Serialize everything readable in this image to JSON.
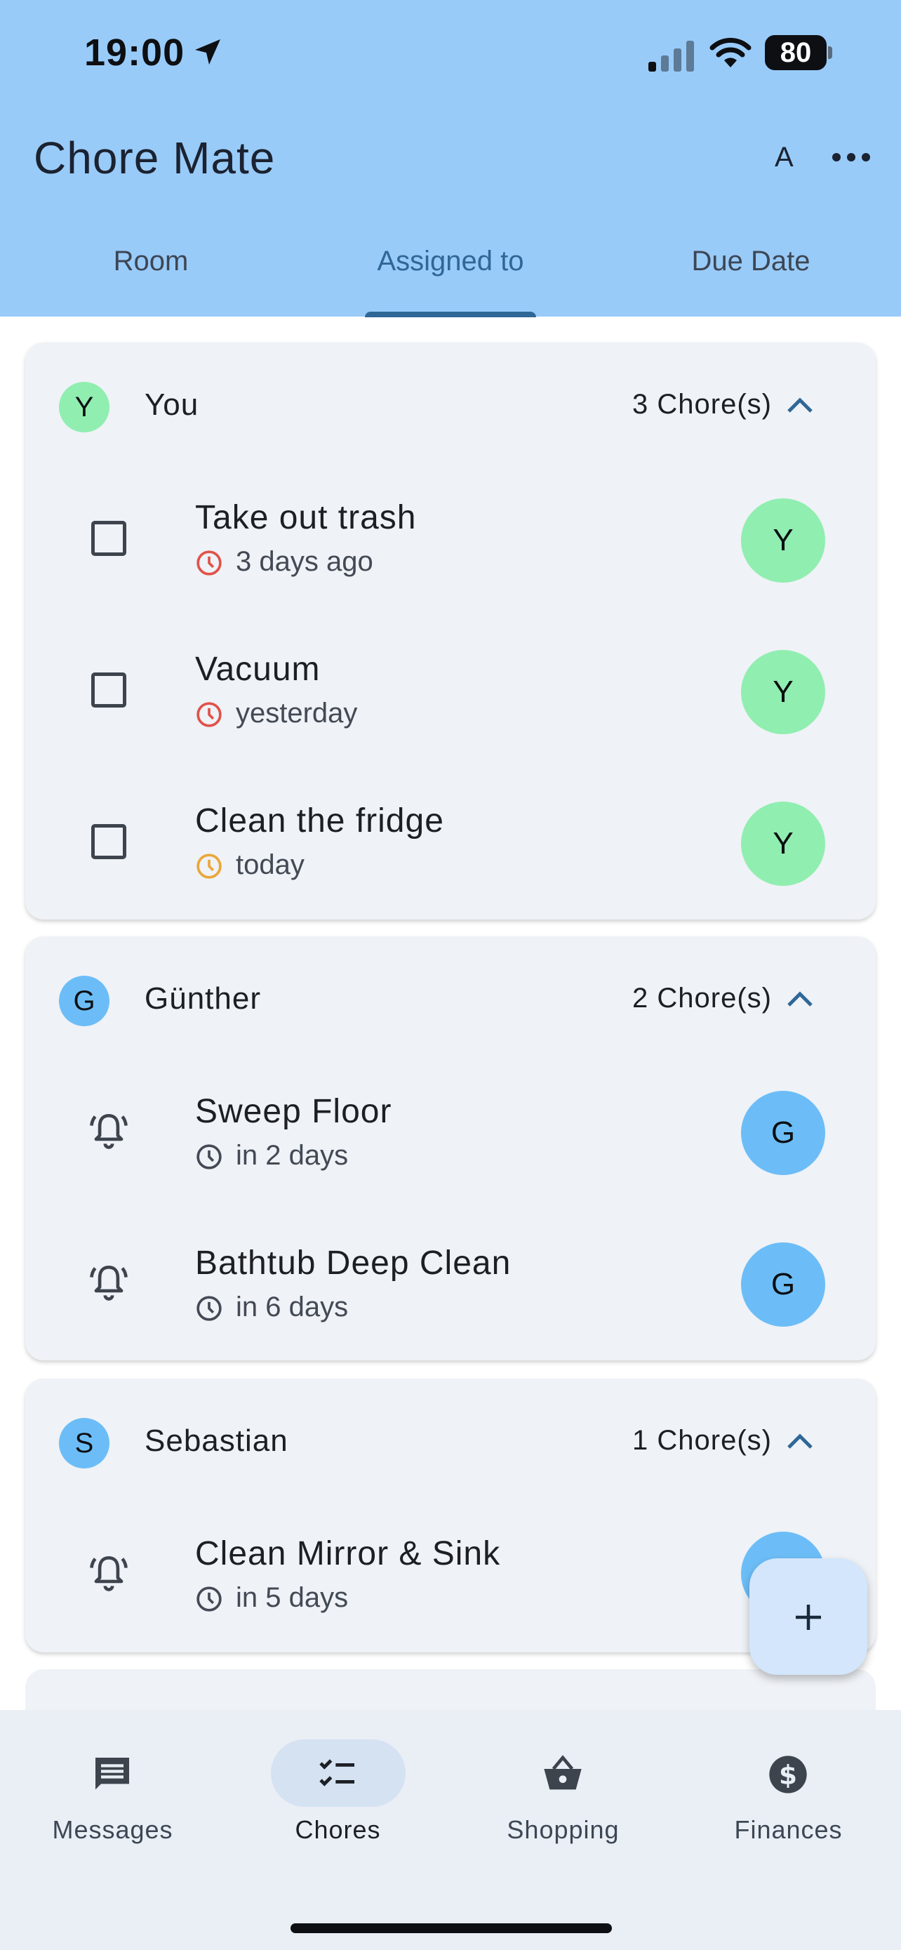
{
  "status_bar": {
    "time": "19:00",
    "battery_level": "80"
  },
  "header": {
    "title": "Chore Mate",
    "font_button": "A"
  },
  "tabs": [
    {
      "label": "Room",
      "active": false
    },
    {
      "label": "Assigned to",
      "active": true
    },
    {
      "label": "Due Date",
      "active": false
    }
  ],
  "groups": [
    {
      "initial": "Y",
      "name": "You",
      "count": "3 Chore(s)",
      "avatar_color": "#90eeb0",
      "chores": [
        {
          "title": "Take out trash",
          "due": "3 days ago",
          "due_color": "#e0524a",
          "avatar": "Y"
        },
        {
          "title": "Vacuum",
          "due": "yesterday",
          "due_color": "#e0524a",
          "avatar": "Y"
        },
        {
          "title": "Clean the fridge",
          "due": "today",
          "due_color": "#eba63a",
          "avatar": "Y"
        }
      ]
    },
    {
      "initial": "G",
      "name": "Günther",
      "count": "2 Chore(s)",
      "avatar_color": "#6cbdf7",
      "chores": [
        {
          "title": "Sweep Floor",
          "due": "in 2 days",
          "due_color": "#434a55",
          "avatar": "G"
        },
        {
          "title": "Bathtub Deep Clean",
          "due": "in 6 days",
          "due_color": "#434a55",
          "avatar": "G"
        }
      ]
    },
    {
      "initial": "S",
      "name": "Sebastian",
      "count": "1 Chore(s)",
      "avatar_color": "#6cbdf7",
      "chores": [
        {
          "title": "Clean Mirror & Sink",
          "due": "in 5 days",
          "due_color": "#434a55",
          "avatar": "S"
        }
      ]
    }
  ],
  "bottom_nav": [
    {
      "label": "Messages",
      "icon": "messages-icon",
      "active": false
    },
    {
      "label": "Chores",
      "icon": "chores-icon",
      "active": true
    },
    {
      "label": "Shopping",
      "icon": "basket-icon",
      "active": false
    },
    {
      "label": "Finances",
      "icon": "dollar-icon",
      "active": false
    }
  ],
  "colors": {
    "appbar": "#99cbf9",
    "accent": "#2f6796",
    "card": "#eff2f6",
    "fab": "#d3e6fb"
  }
}
